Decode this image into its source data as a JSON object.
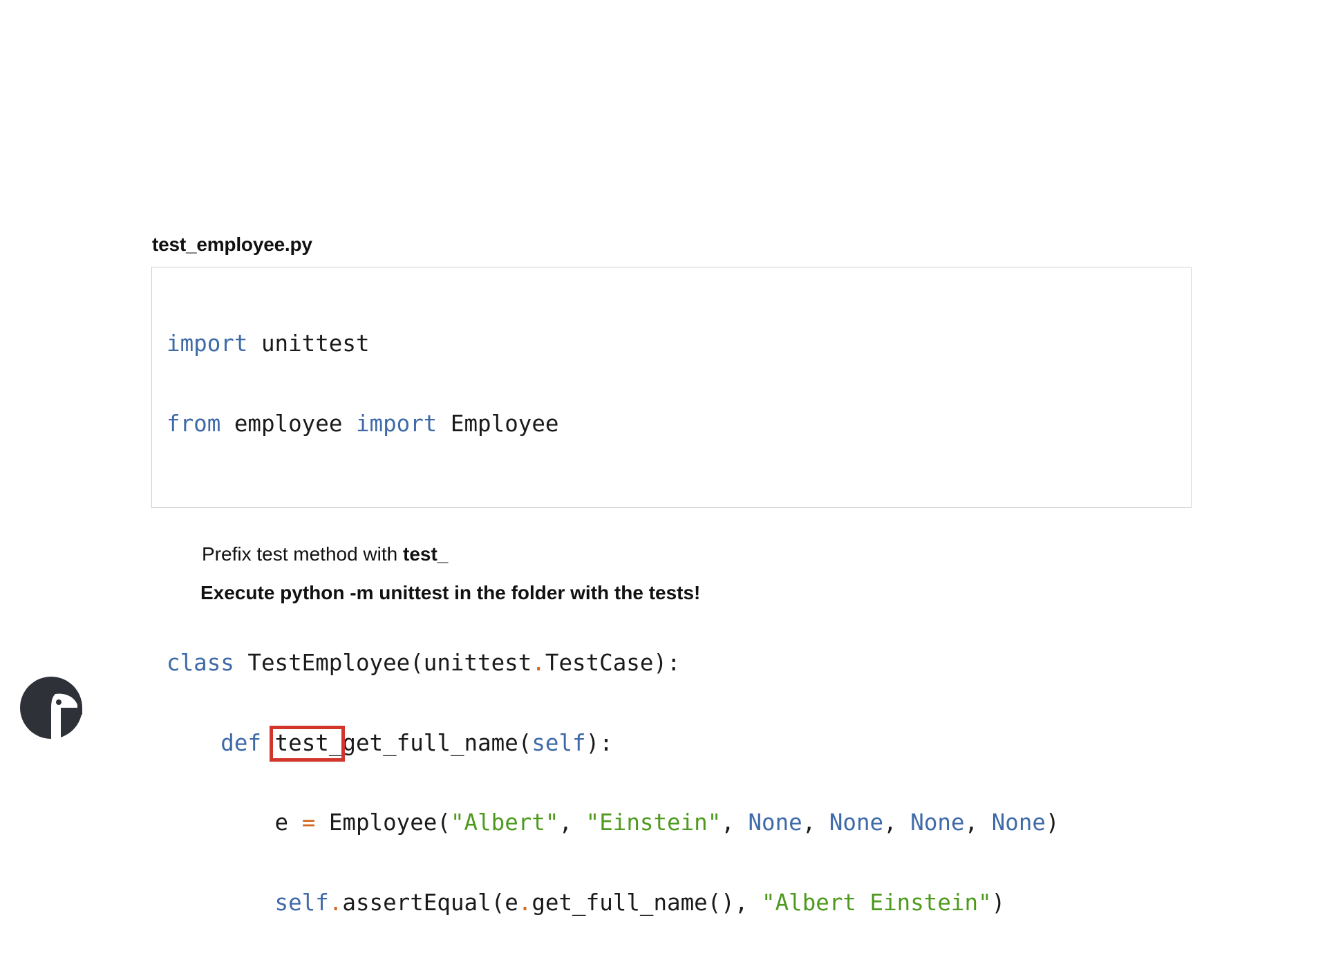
{
  "file_title": "test_employee.py",
  "code": {
    "line1": {
      "kw1": "import",
      "text1": " unittest"
    },
    "line2": {
      "kw1": "from",
      "text1": " employee ",
      "kw2": "import",
      "text2": " Employee"
    },
    "line5": {
      "kw1": "class",
      "text1": " TestEmployee(unittest",
      "op1": ".",
      "text2": "TestCase):"
    },
    "line6": {
      "indent": "    ",
      "kw1": "def",
      "space": " ",
      "highlight": "test_",
      "text1": "get_full_name(",
      "kw2": "self",
      "text2": "):"
    },
    "line7": {
      "indent": "        ",
      "text1": "e ",
      "op1": "=",
      "text2": " Employee(",
      "str1": "\"Albert\"",
      "c1": ", ",
      "str2": "\"Einstein\"",
      "c2": ", ",
      "n1": "None",
      "c3": ", ",
      "n2": "None",
      "c4": ", ",
      "n3": "None",
      "c5": ", ",
      "n4": "None",
      "end": ")"
    },
    "line8": {
      "indent": "        ",
      "kw1": "self",
      "op1": ".",
      "text1": "assertEqual(e",
      "op2": ".",
      "text2": "get_full_name(), ",
      "str1": "\"Albert Einstein\"",
      "end": ")"
    }
  },
  "notes": {
    "note1_prefix": "Prefix test method with ",
    "note1_bold": "test_",
    "note2": "Execute python -m unittest in the folder with the tests!"
  },
  "colors": {
    "keyword": "#3f6aa8",
    "string": "#4e9a1e",
    "operator": "#d2691e",
    "highlight_border": "#d1352b",
    "logo": "#2e3138"
  },
  "logo": {
    "icon": "python-snake-logo-icon"
  }
}
